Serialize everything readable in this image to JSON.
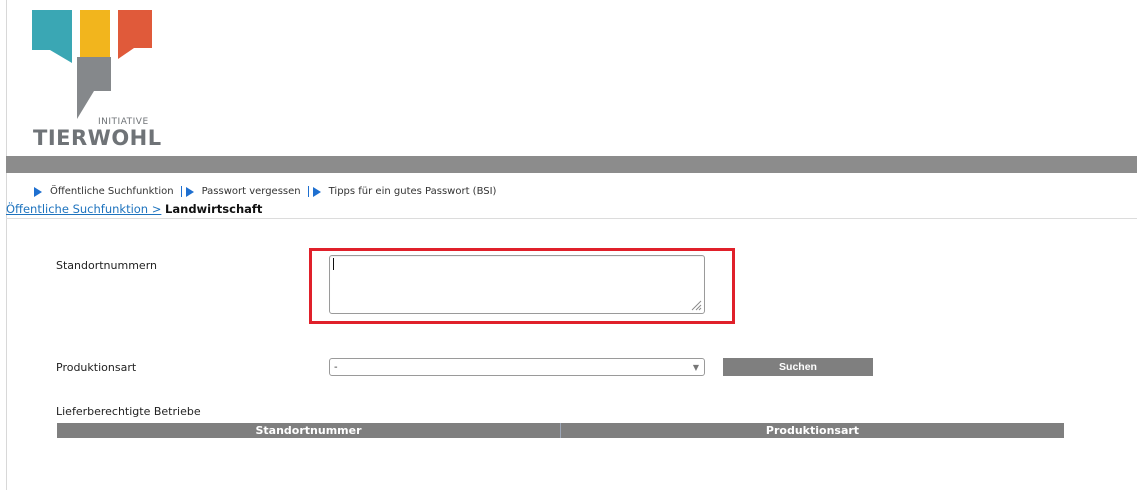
{
  "logo": {
    "small_text": "INITIATIVE",
    "big_text": "TIERWOHL",
    "colors": {
      "teal": "#3aa7b4",
      "yellow": "#f2b51d",
      "orange": "#e05a3a",
      "gray": "#85888b"
    }
  },
  "nav": {
    "items": [
      {
        "label": "Öffentliche Suchfunktion"
      },
      {
        "label": "Passwort vergessen"
      },
      {
        "label": "Tipps für ein gutes Passwort (BSI)"
      }
    ]
  },
  "breadcrumb": {
    "link": "Öffentliche Suchfunktion >",
    "current": "Landwirtschaft"
  },
  "form": {
    "standort_label": "Standortnummern",
    "standort_value": "",
    "produktion_label": "Produktionsart",
    "produktion_selected": "-",
    "search_button": "Suchen"
  },
  "results": {
    "title": "Lieferberechtigte Betriebe",
    "columns": [
      "Standortnummer",
      "Produktionsart"
    ]
  },
  "colors": {
    "highlight": "#e0202a",
    "header_bar": "#8c8c8c",
    "link": "#1e73be"
  }
}
